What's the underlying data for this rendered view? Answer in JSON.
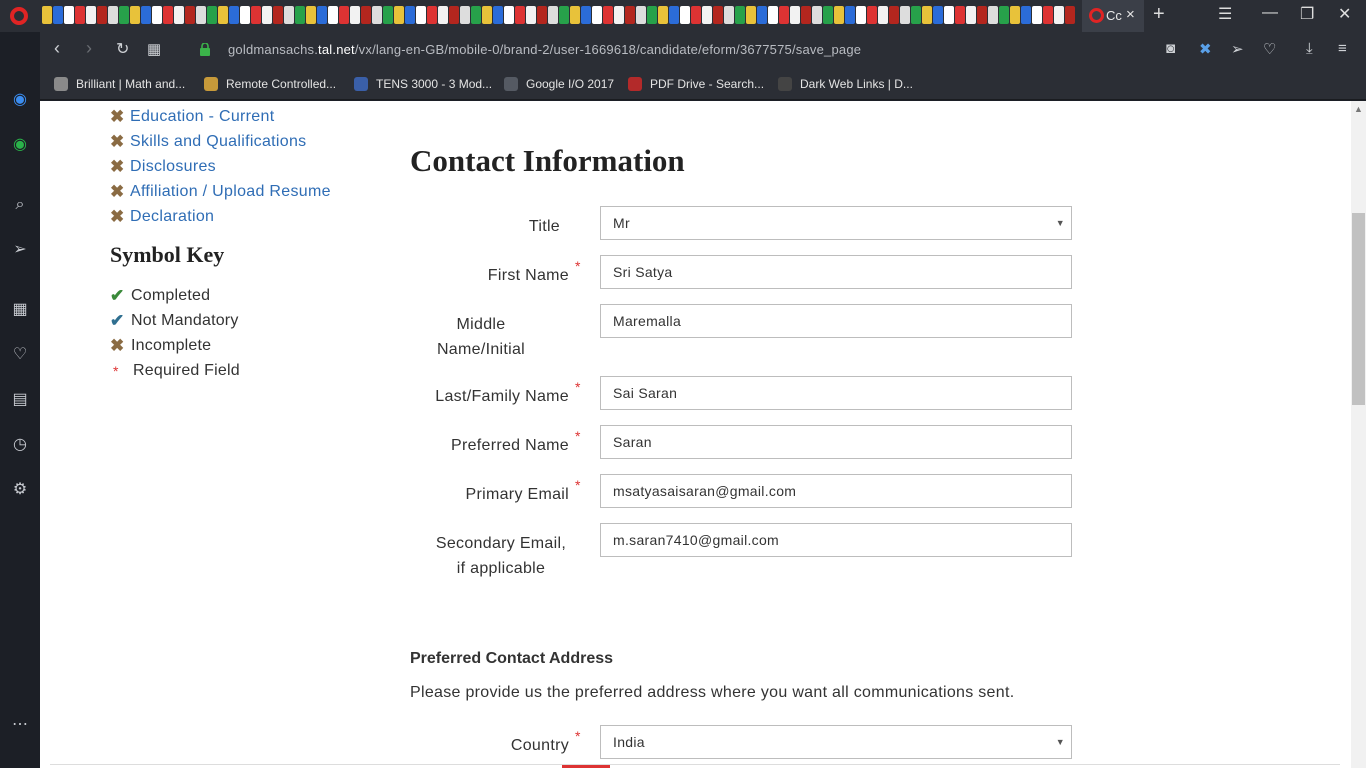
{
  "browser": {
    "active_tab_label": "Cc",
    "active_tab_close": "×",
    "new_tab": "+",
    "url_prefix": "goldmansachs.",
    "url_domain": "tal.net",
    "url_path": "/vx/lang-en-GB/mobile-0/brand-2/user-1669618/candidate/eform/3677575/save_page"
  },
  "bookmarks": [
    {
      "label": "Brilliant | Math and...",
      "color": "#8a8a8a"
    },
    {
      "label": "Remote Controlled...",
      "color": "#c79a3a"
    },
    {
      "label": "TENS 3000 - 3 Mod...",
      "color": "#3a5fa8"
    },
    {
      "label": "Google I/O 2017",
      "color": "#555a63"
    },
    {
      "label": "PDF Drive - Search...",
      "color": "#b32a2a"
    },
    {
      "label": "Dark Web Links | D...",
      "color": "#444"
    }
  ],
  "sections_nav": [
    {
      "label": "Education - Current"
    },
    {
      "label": "Skills and Qualifications"
    },
    {
      "label": "Disclosures"
    },
    {
      "label": "Affiliation / Upload Resume"
    },
    {
      "label": "Declaration"
    }
  ],
  "symbol_key": {
    "title": "Symbol Key",
    "completed": "Completed",
    "not_mandatory": "Not Mandatory",
    "incomplete": "Incomplete",
    "required": "Required Field"
  },
  "form": {
    "title": "Contact Information",
    "title_label": "Title",
    "title_value": "Mr",
    "first_name_label": "First Name",
    "first_name_value": "Sri Satya",
    "middle_label_1": "Middle",
    "middle_label_2": "Name/Initial",
    "middle_value": "Maremalla",
    "last_name_label": "Last/Family Name",
    "last_name_value": "Sai Saran",
    "preferred_label": "Preferred Name",
    "preferred_value": "Saran",
    "primary_email_label": "Primary Email",
    "primary_email_value": "msatyasaisaran@gmail.com",
    "secondary_label_1": "Secondary Email,",
    "secondary_label_2": "if applicable",
    "secondary_value": "m.saran7410@gmail.com",
    "address_title": "Preferred Contact Address",
    "address_desc": "Please provide us the preferred address where you want all communications sent.",
    "country_label": "Country",
    "country_value": "India",
    "required_marker": "*"
  },
  "icons": {
    "x_mark": "✖",
    "check": "✔",
    "caret": "▼"
  },
  "colors": {
    "link": "#2f6db5",
    "incomplete_mark": "#8a6b43",
    "required": "#dd3333",
    "opera_red": "#e02424"
  }
}
